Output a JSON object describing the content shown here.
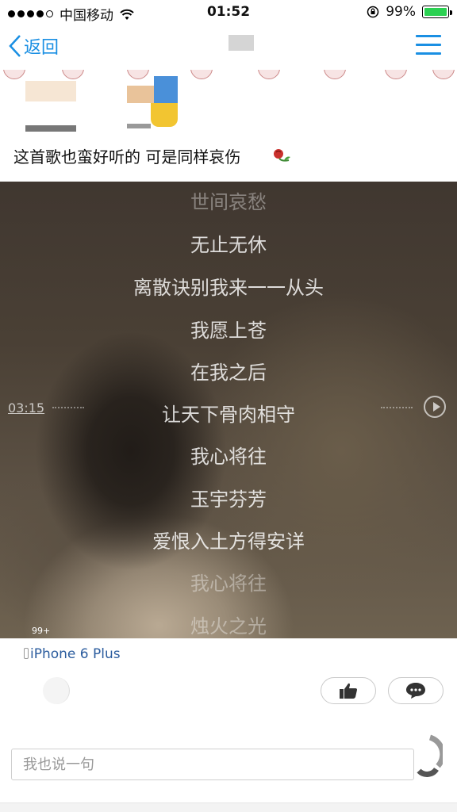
{
  "status_bar": {
    "carrier": "中国移动",
    "time": "01:52",
    "battery_text": "99%",
    "battery_level": 0.99,
    "battery_color": "#2bd152"
  },
  "nav": {
    "back_label": "返回",
    "back_icon": "chevron-left-icon",
    "menu_icon": "hamburger-icon",
    "accent_color": "#1a8fe3"
  },
  "post": {
    "comment": "这首歌也蛮好听的  可是同样哀伤",
    "emoji_icon": "rose-icon"
  },
  "video": {
    "time": "03:15",
    "badge": "99+",
    "lyrics": [
      "世间哀愁",
      "无止无休",
      "离散诀别我来一一从头",
      "我愿上苍",
      "在我之后",
      "让天下骨肉相守",
      "我心将往",
      "玉宇芬芳",
      "爱恨入土方得安详",
      "我心将往",
      "烛火之光"
    ]
  },
  "footer": {
    "device": "iPhone 6 Plus",
    "like_icon": "thumbs-up-icon",
    "comment_icon": "comment-bubble-icon",
    "input_placeholder": "我也说一句"
  }
}
